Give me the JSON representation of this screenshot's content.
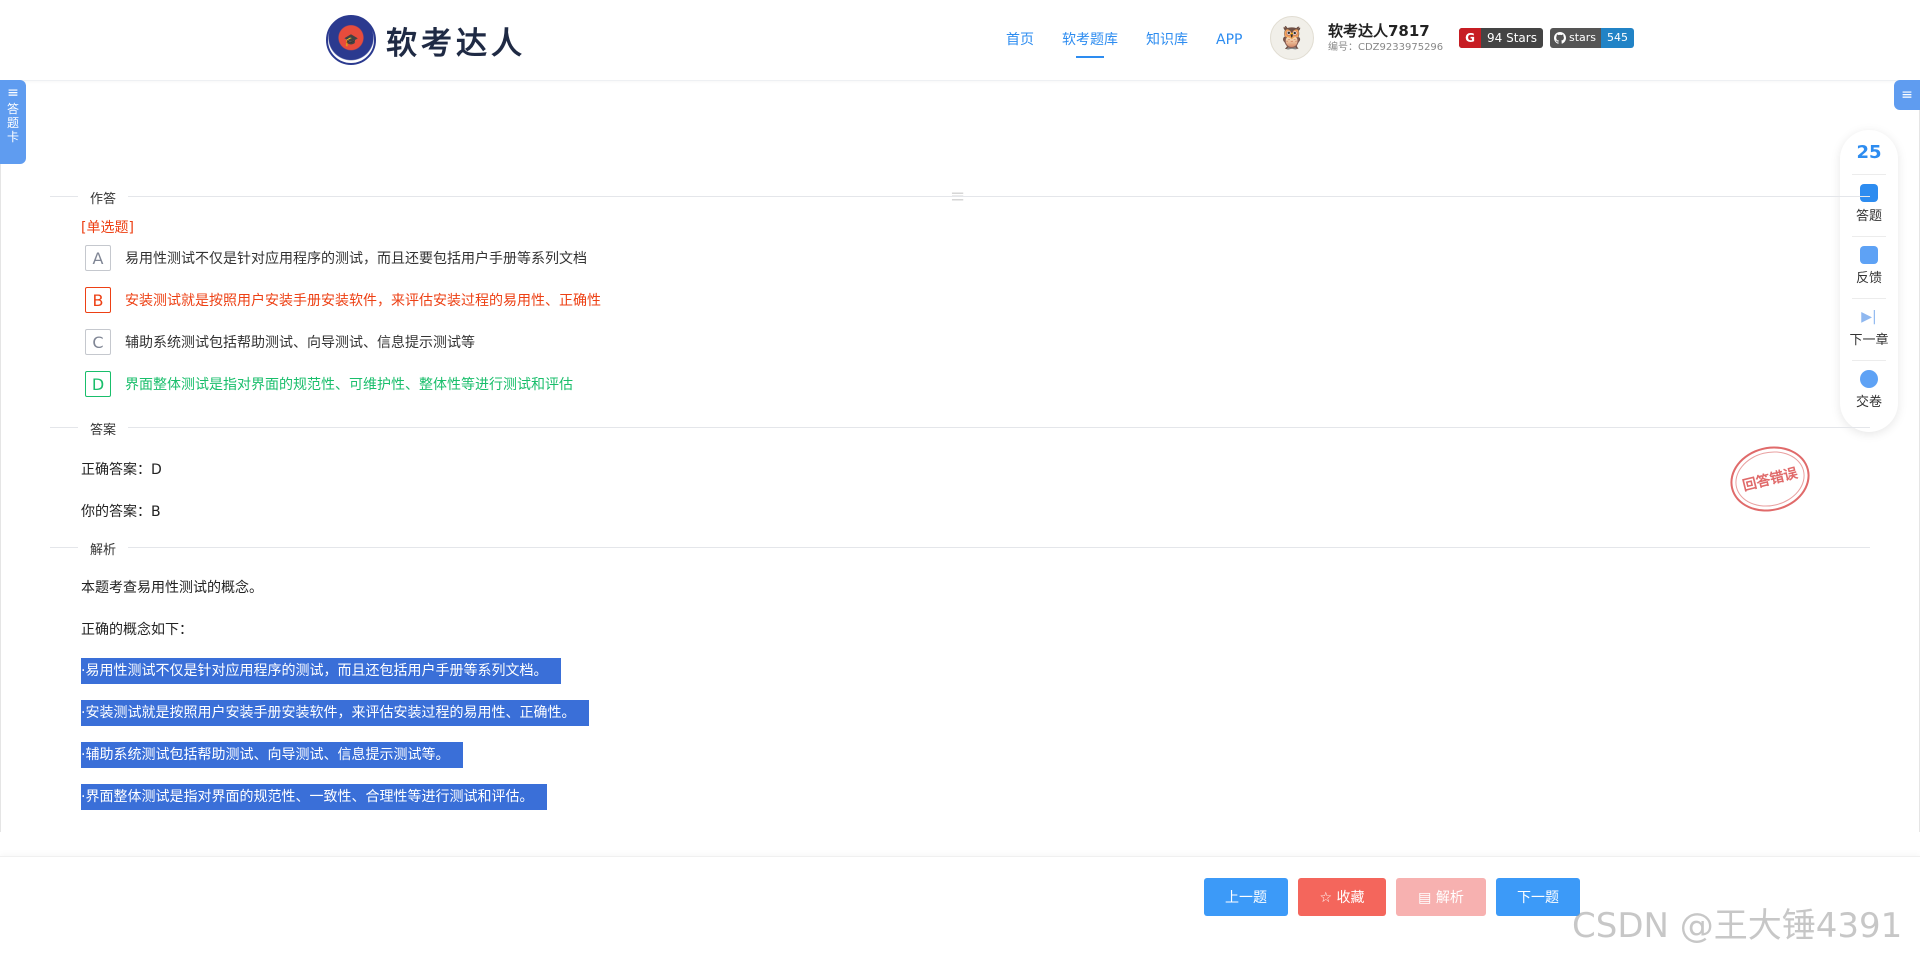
{
  "header": {
    "brand": "软考达人",
    "nav": [
      "首页",
      "软考题库",
      "知识库",
      "APP"
    ],
    "nav_active": 1,
    "user_name": "软考达人7817",
    "user_id": "编号：CDZ9233975296",
    "gitee_badge": "94 Stars",
    "github_badge_left": "stars",
    "github_badge_right": "545"
  },
  "answer_card_tab": "答题卡",
  "float_panel": {
    "count": "25",
    "items": [
      "答题",
      "反馈",
      "下一章",
      "交卷"
    ]
  },
  "sections": {
    "work": "作答",
    "answer": "答案",
    "analysis": "解析"
  },
  "question": {
    "type": "[单选题]",
    "options": [
      {
        "key": "A",
        "text": "易用性测试不仅是针对应用程序的测试，而且还要包括用户手册等系列文档",
        "state": "normal"
      },
      {
        "key": "B",
        "text": "安装测试就是按照用户安装手册安装软件，来评估安装过程的易用性、正确性",
        "state": "wrong"
      },
      {
        "key": "C",
        "text": "辅助系统测试包括帮助测试、向导测试、信息提示测试等",
        "state": "normal"
      },
      {
        "key": "D",
        "text": "界面整体测试是指对界面的规范性、可维护性、整体性等进行测试和评估",
        "state": "right"
      }
    ]
  },
  "answer": {
    "correct": "正确答案：D",
    "yours": "你的答案：B",
    "stamp": "回答错误"
  },
  "analysis": {
    "p1": "本题考查易用性测试的概念。",
    "p2": "正确的概念如下：",
    "highlights": [
      "·易用性测试不仅是针对应用程序的测试，而且还包括用户手册等系列文档。",
      "·安装测试就是按照用户安装手册安装软件，来评估安装过程的易用性、正确性。",
      "·辅助系统测试包括帮助测试、向导测试、信息提示测试等。",
      "·界面整体测试是指对界面的规范性、一致性、合理性等进行测试和评估。"
    ]
  },
  "buttons": {
    "prev": "上一题",
    "fav": "☆ 收藏",
    "analysis": "▤ 解析",
    "next": "下一题"
  },
  "watermark": "CSDN @王大锤4391",
  "colors": {
    "accent": "#2d8cf0",
    "wrong": "#ed4014",
    "right": "#19be6b",
    "highlight": "#3a6fd8"
  }
}
